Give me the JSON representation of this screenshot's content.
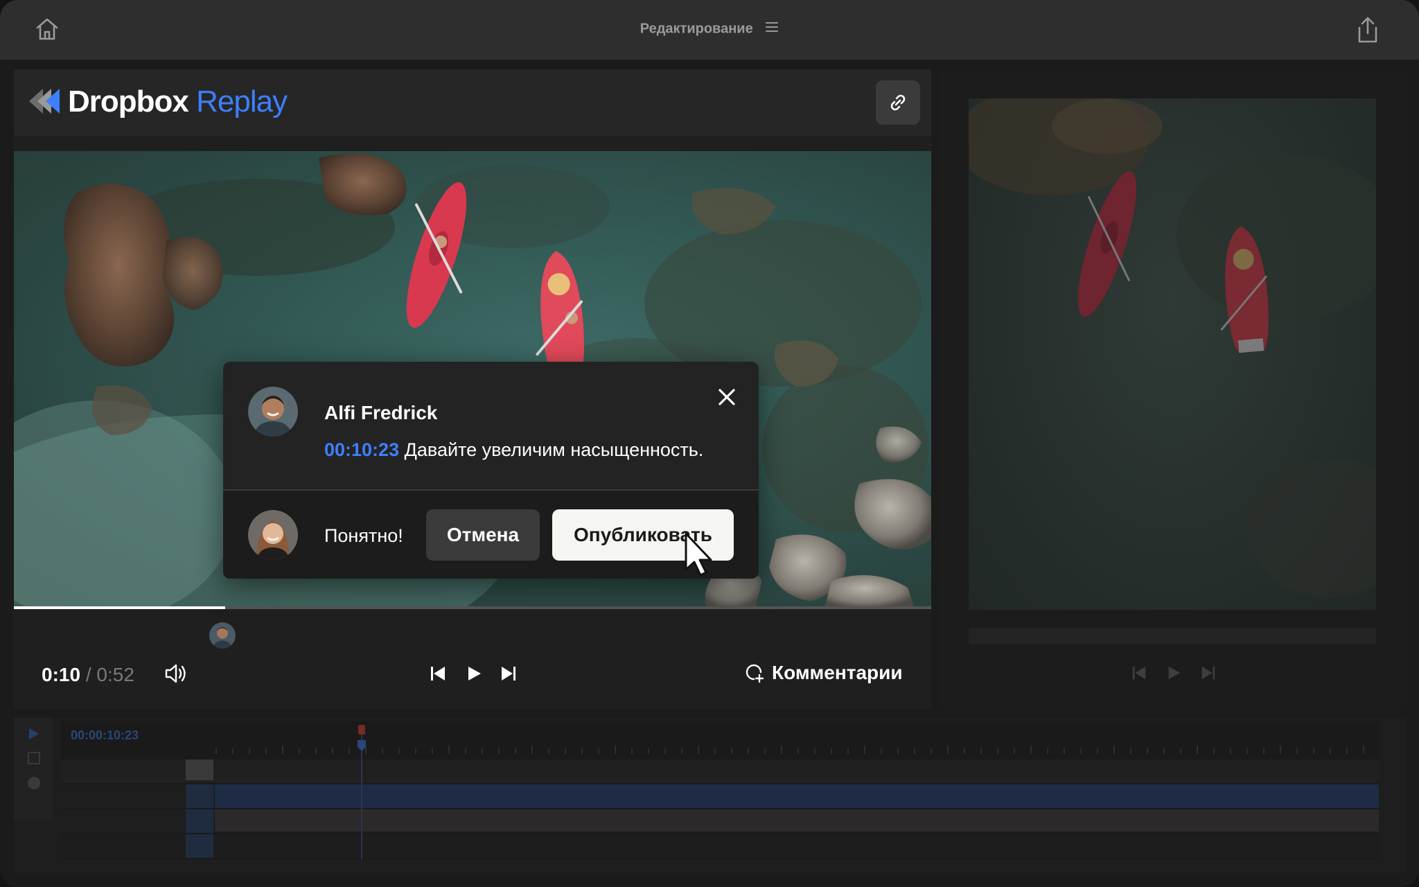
{
  "window": {
    "title": "Редактирование"
  },
  "brand": {
    "name_primary": "Dropbox",
    "name_secondary": "Replay",
    "accent": "#3d7fff"
  },
  "player": {
    "current_time": "0:10",
    "separator": " / ",
    "duration": "0:52",
    "progress": 0.23,
    "comments_label": "Комментарии"
  },
  "comment_popup": {
    "author": "Alfi Fredrick",
    "timestamp": "00:10:23",
    "text": " Давайте увеличим насыщенность.",
    "reply_text": "Понятно!",
    "cancel_label": "Отмена",
    "publish_label": "Опубликовать"
  },
  "timeline": {
    "timecode": "00:00:10:23"
  },
  "icons": {
    "home": "home-icon",
    "menu": "menu-icon",
    "share": "share-icon",
    "link": "link-icon",
    "volume": "volume-icon",
    "prev_frame": "step-back-icon",
    "play": "play-icon",
    "next_frame": "step-forward-icon",
    "add_comment": "add-comment-icon",
    "close": "close-icon",
    "cursor": "cursor-icon"
  }
}
